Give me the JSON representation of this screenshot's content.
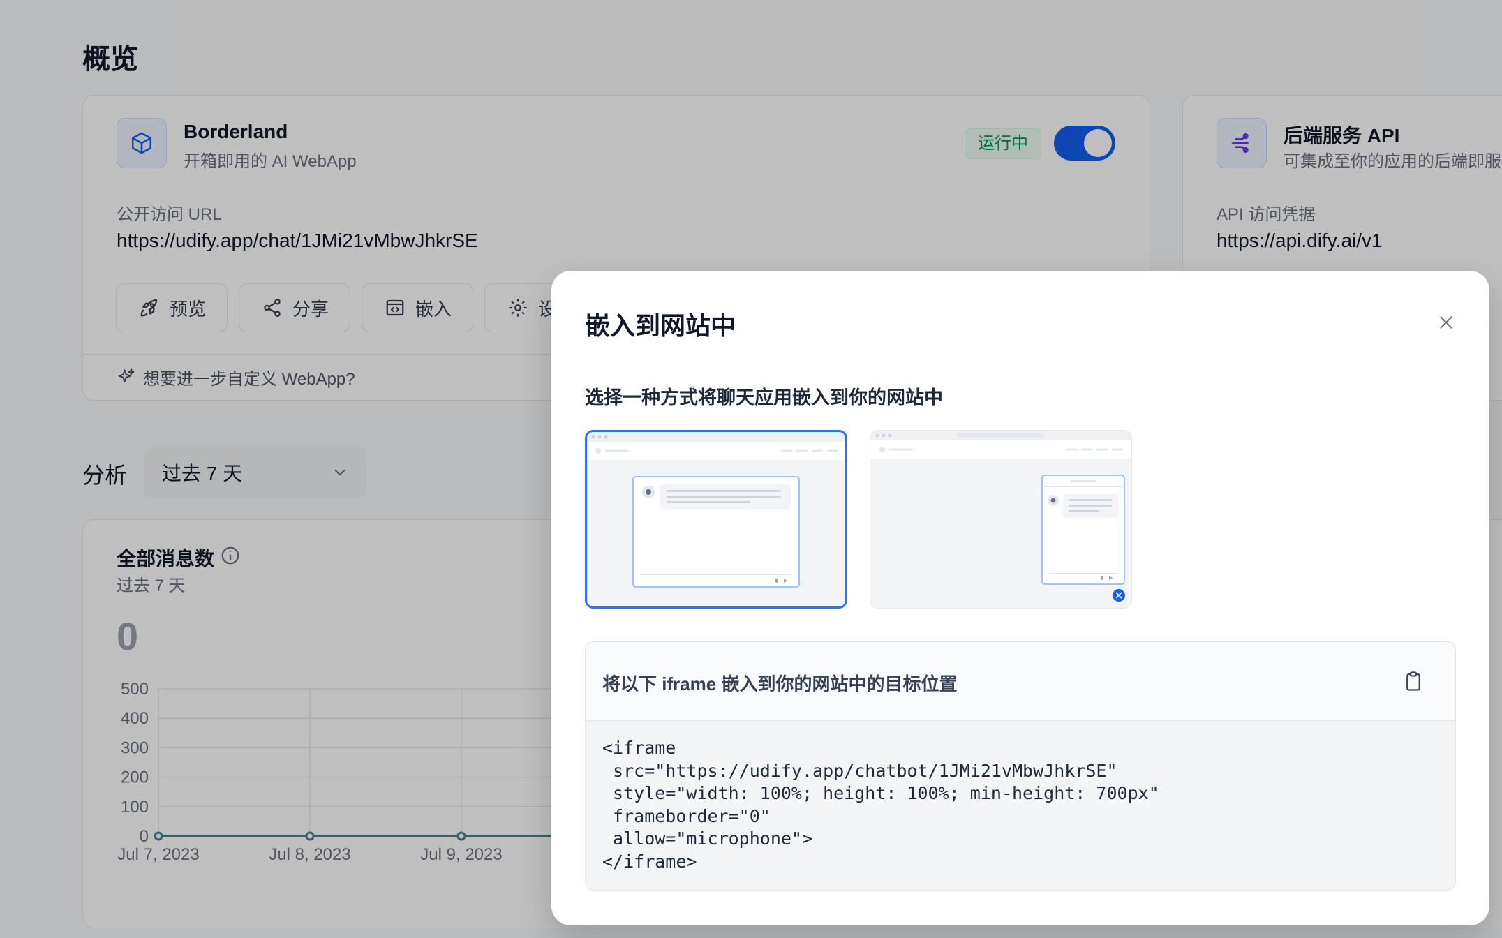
{
  "page": {
    "title": "概览"
  },
  "webapp_card": {
    "name": "Borderland",
    "subtitle": "开箱即用的 AI WebApp",
    "status": "运行中",
    "enabled": true,
    "url_label": "公开访问 URL",
    "url": "https://udify.app/chat/1JMi21vMbwJhkrSE",
    "buttons": {
      "preview": "预览",
      "share": "分享",
      "embed": "嵌入",
      "settings": "设"
    },
    "footer_text": "想要进一步自定义 WebApp?"
  },
  "api_card": {
    "name": "后端服务 API",
    "subtitle": "可集成至你的应用的后端即服",
    "cred_label": "API 访问凭据",
    "url": "https://api.dify.ai/v1"
  },
  "analysis": {
    "label": "分析",
    "period": "过去 7 天"
  },
  "chart": {
    "title": "全部消息数",
    "subtitle": "过去 7 天",
    "total": "0"
  },
  "chart_data": {
    "type": "line",
    "title": "全部消息数",
    "categories": [
      "Jul 7, 2023",
      "Jul 8, 2023",
      "Jul 9, 2023"
    ],
    "values": [
      0,
      0,
      0
    ],
    "y_ticks": [
      "500",
      "400",
      "300",
      "200",
      "100",
      "0"
    ],
    "ylim": [
      0,
      500
    ],
    "grid": true,
    "colors": {
      "line": "#4a7f8f"
    }
  },
  "modal": {
    "title": "嵌入到网站中",
    "description": "选择一种方式将聊天应用嵌入到你的网站中",
    "options": [
      "iframe",
      "bubble"
    ],
    "selected": "iframe",
    "code_header": "将以下 iframe 嵌入到你的网站中的目标位置",
    "code": "<iframe\n src=\"https://udify.app/chatbot/1JMi21vMbwJhkrSE\"\n style=\"width: 100%; height: 100%; min-height: 700px\"\n frameborder=\"0\"\n allow=\"microphone\">\n</iframe>"
  },
  "icons": [
    "cube-icon",
    "api-icon",
    "rocket-icon",
    "share-icon",
    "embed-icon",
    "gear-icon",
    "sparkle-icon",
    "chevron-down-icon",
    "info-icon",
    "close-icon",
    "clipboard-icon"
  ],
  "colors": {
    "accent": "#155eef",
    "status": "#039855",
    "overlay": "rgba(0,0,0,0.25)"
  }
}
